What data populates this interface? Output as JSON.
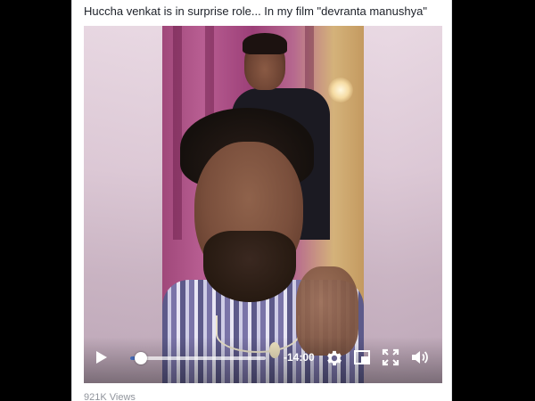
{
  "post": {
    "caption": "Huccha venkat is in surprise role... In my film \"devranta manushya\"",
    "views": "921K Views"
  },
  "video": {
    "time_remaining": "-14:00",
    "progress": 0.08,
    "controls": {
      "play": "play-icon",
      "settings": "gear-icon",
      "pip": "picture-in-picture-icon",
      "fullscreen": "fullscreen-icon",
      "volume": "volume-icon"
    }
  },
  "colors": {
    "accent": "#4267b2",
    "caption_text": "#1d2129",
    "muted_text": "#90949c"
  }
}
